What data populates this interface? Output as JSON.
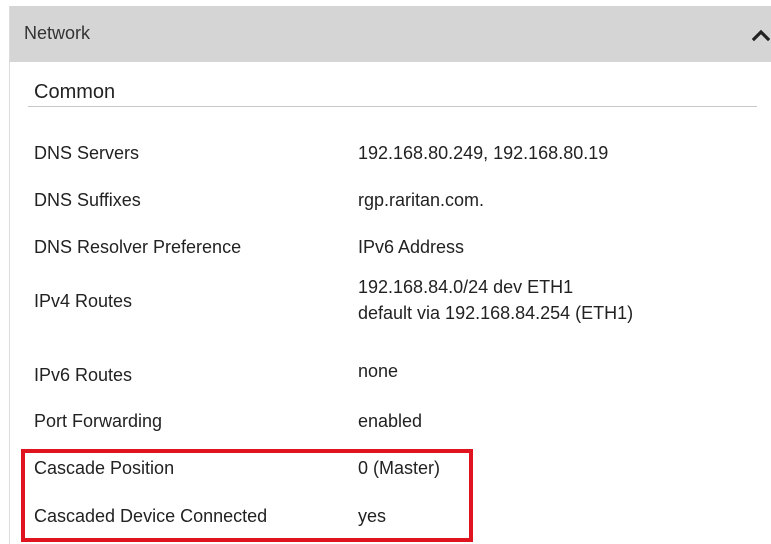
{
  "panel": {
    "title": "Network",
    "collapse_icon": "chevron-up-icon"
  },
  "section": {
    "title": "Common"
  },
  "rows": [
    {
      "label": "DNS Servers",
      "values": [
        "192.168.80.249, 192.168.80.19"
      ]
    },
    {
      "label": "DNS Suffixes",
      "values": [
        "rgp.raritan.com."
      ]
    },
    {
      "label": "DNS Resolver Preference",
      "values": [
        "IPv6 Address"
      ]
    },
    {
      "label": "IPv4 Routes",
      "values": [
        "192.168.84.0/24 dev ETH1",
        "default via 192.168.84.254 (ETH1)"
      ]
    },
    {
      "label": "IPv6 Routes",
      "values": [
        "none"
      ]
    },
    {
      "label": "Port Forwarding",
      "values": [
        "enabled"
      ]
    },
    {
      "label": "Cascade Position",
      "values": [
        "0 (Master)"
      ]
    },
    {
      "label": "Cascaded Device Connected",
      "values": [
        "yes"
      ]
    }
  ],
  "colors": {
    "header_bg": "#d5d5d5",
    "highlight": "#e0141e"
  }
}
